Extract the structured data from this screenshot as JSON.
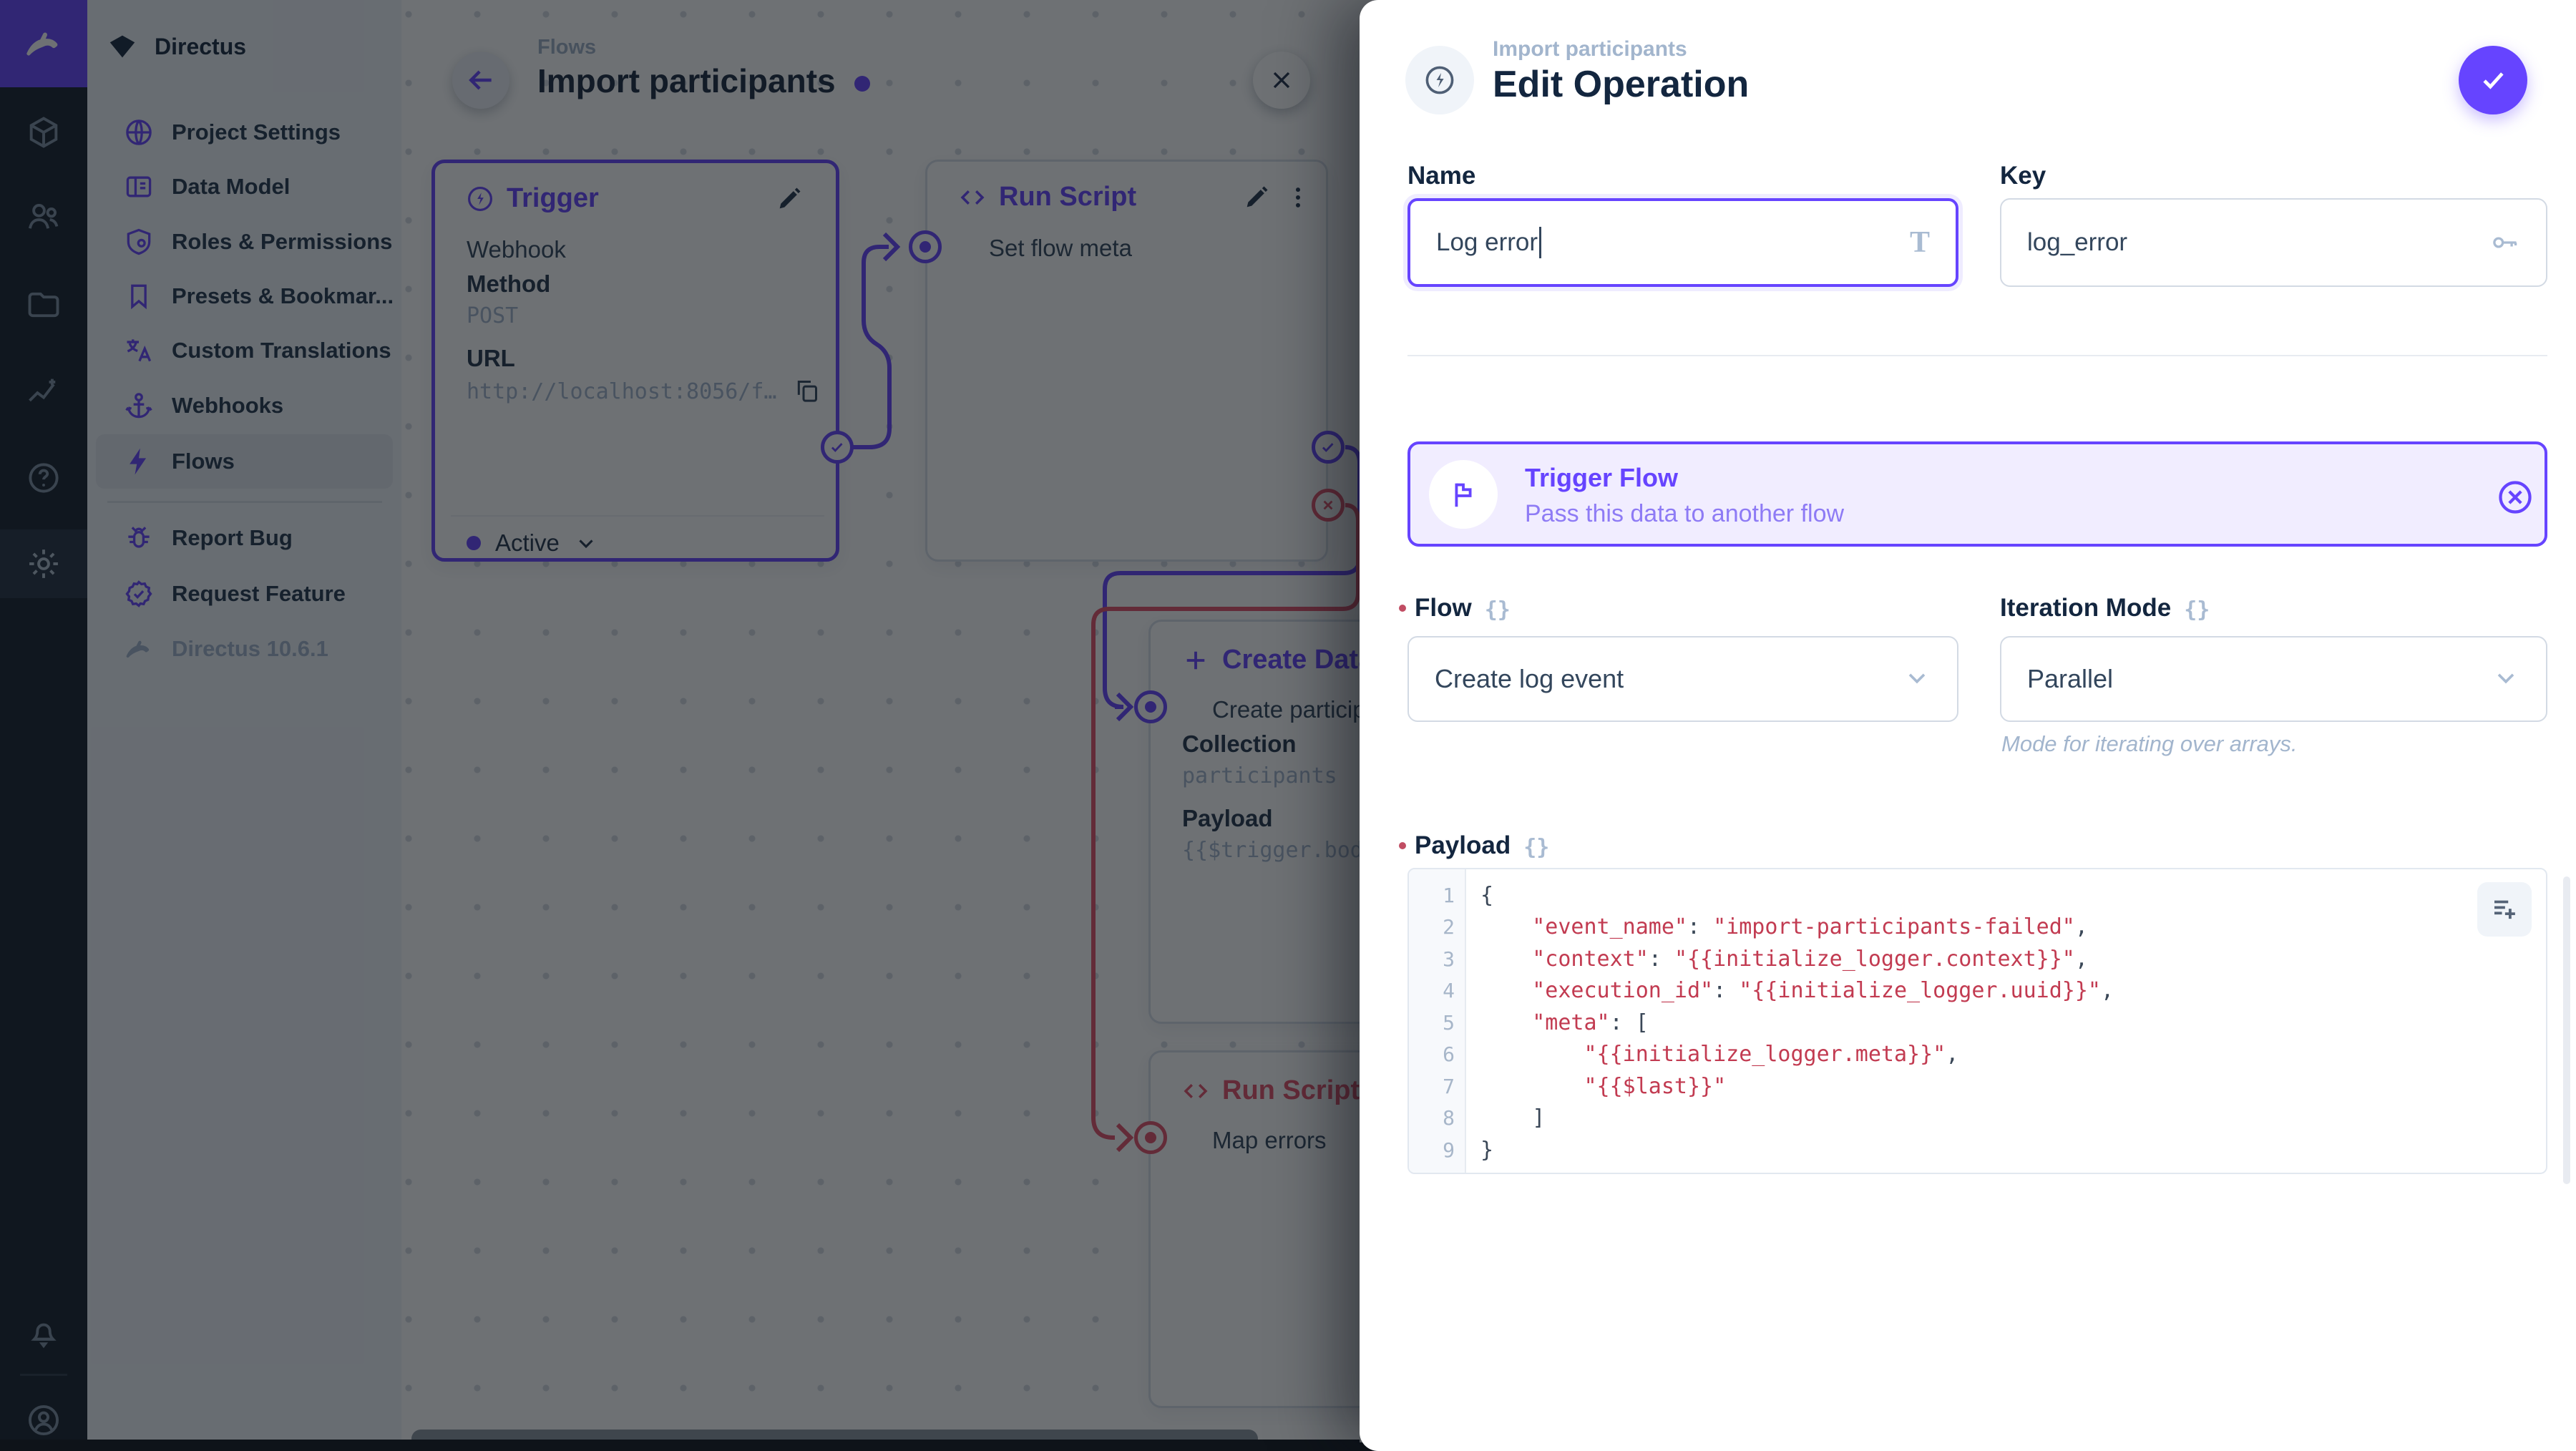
{
  "colors": {
    "accent": "#6644FF",
    "danger": "#E35169",
    "dark": "#172940",
    "muted": "#A2B5CD"
  },
  "module_bar": {
    "icons": [
      "directus-logo",
      "box",
      "people",
      "folder",
      "activity",
      "help",
      "settings",
      "bell",
      "user"
    ]
  },
  "nav": {
    "project": "Directus",
    "items": [
      {
        "label": "Project Settings",
        "icon": "globe"
      },
      {
        "label": "Data Model",
        "icon": "data-model"
      },
      {
        "label": "Roles & Permissions",
        "icon": "shield"
      },
      {
        "label": "Presets & Bookmar...",
        "icon": "bookmark"
      },
      {
        "label": "Custom Translations",
        "icon": "translate"
      },
      {
        "label": "Webhooks",
        "icon": "anchor"
      },
      {
        "label": "Flows",
        "icon": "bolt",
        "active": true
      }
    ],
    "footer_items": [
      {
        "label": "Report Bug",
        "icon": "bug"
      },
      {
        "label": "Request Feature",
        "icon": "medal"
      }
    ],
    "version": "Directus 10.6.1"
  },
  "flow_header": {
    "breadcrumb": "Flows",
    "title": "Import participants"
  },
  "canvas": {
    "trigger_card": {
      "title": "Trigger",
      "type": "Webhook",
      "method_label": "Method",
      "method": "POST",
      "url_label": "URL",
      "url": "http://localhost:8056/f…",
      "status": "Active"
    },
    "run_script_card": {
      "title": "Run Script",
      "name": "Set flow meta"
    },
    "create_data_card": {
      "title": "Create Data",
      "name": "Create participan",
      "collection_label": "Collection",
      "collection": "participants",
      "payload_label": "Payload",
      "payload_preview": "{{$trigger.bod"
    },
    "map_errors_card": {
      "title": "Run Script",
      "name": "Map errors"
    }
  },
  "drawer": {
    "breadcrumb": "Import participants",
    "title": "Edit Operation",
    "name_field": {
      "label": "Name",
      "value": "Log error"
    },
    "key_field": {
      "label": "Key",
      "value": "log_error"
    },
    "banner": {
      "title": "Trigger Flow",
      "subtitle": "Pass this data to another flow"
    },
    "flow_field": {
      "label": "Flow",
      "value": "Create log event"
    },
    "iteration_field": {
      "label": "Iteration Mode",
      "value": "Parallel",
      "note": "Mode for iterating over arrays."
    },
    "payload_field": {
      "label": "Payload"
    },
    "code": {
      "lines": [
        {
          "n": "1",
          "tokens": [
            [
              "p",
              "{"
            ]
          ]
        },
        {
          "n": "2",
          "tokens": [
            [
              "p",
              "    "
            ],
            [
              "s",
              "\"event_name\""
            ],
            [
              "p",
              ": "
            ],
            [
              "s",
              "\"import-participants-failed\""
            ],
            [
              "p",
              ","
            ]
          ]
        },
        {
          "n": "3",
          "tokens": [
            [
              "p",
              "    "
            ],
            [
              "s",
              "\"context\""
            ],
            [
              "p",
              ": "
            ],
            [
              "s",
              "\"{{initialize_logger.context}}\""
            ],
            [
              "p",
              ","
            ]
          ]
        },
        {
          "n": "4",
          "tokens": [
            [
              "p",
              "    "
            ],
            [
              "s",
              "\"execution_id\""
            ],
            [
              "p",
              ": "
            ],
            [
              "s",
              "\"{{initialize_logger.uuid}}\""
            ],
            [
              "p",
              ","
            ]
          ]
        },
        {
          "n": "5",
          "tokens": [
            [
              "p",
              "    "
            ],
            [
              "s",
              "\"meta\""
            ],
            [
              "p",
              ": ["
            ]
          ]
        },
        {
          "n": "6",
          "tokens": [
            [
              "p",
              "        "
            ],
            [
              "s",
              "\"{{initialize_logger.meta}}\""
            ],
            [
              "p",
              ","
            ]
          ]
        },
        {
          "n": "7",
          "tokens": [
            [
              "p",
              "        "
            ],
            [
              "s",
              "\"{{$last}}\""
            ]
          ]
        },
        {
          "n": "8",
          "tokens": [
            [
              "p",
              "    ]"
            ]
          ]
        },
        {
          "n": "9",
          "tokens": [
            [
              "p",
              "}"
            ]
          ]
        }
      ]
    }
  }
}
